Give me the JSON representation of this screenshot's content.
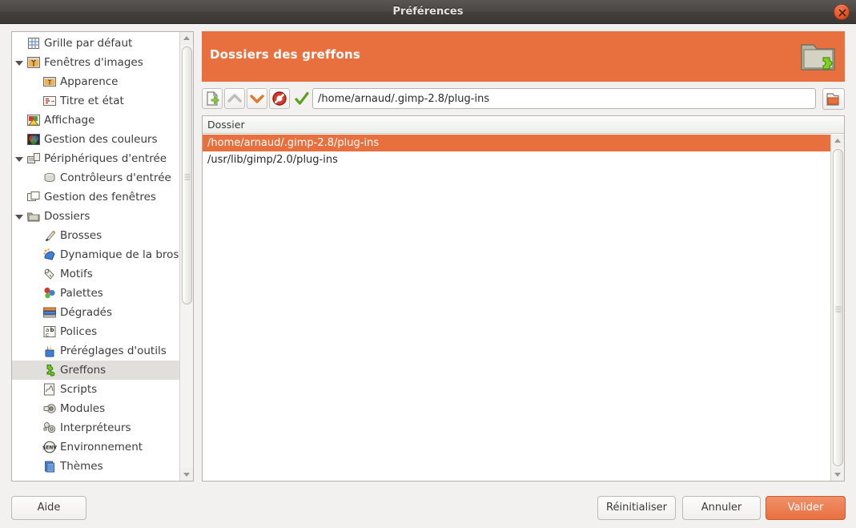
{
  "window": {
    "title": "Préférences",
    "close_icon": "close-icon"
  },
  "colors": {
    "accent": "#e8703f",
    "selection": "#e8703f",
    "tree_selection": "#e0dfdc",
    "panel_bg": "#f2f1f0"
  },
  "sidebar": {
    "items": [
      {
        "label": "Grille par défaut",
        "depth": 0,
        "icon": "grid-icon",
        "expander": "none",
        "selected": false
      },
      {
        "label": "Fenêtres d'images",
        "depth": 0,
        "icon": "image-window-icon",
        "expander": "expanded",
        "selected": false
      },
      {
        "label": "Apparence",
        "depth": 1,
        "icon": "appearance-icon",
        "expander": "none",
        "selected": false
      },
      {
        "label": "Titre et état",
        "depth": 1,
        "icon": "title-status-icon",
        "expander": "none",
        "selected": false
      },
      {
        "label": "Affichage",
        "depth": 0,
        "icon": "display-icon",
        "expander": "none",
        "selected": false
      },
      {
        "label": "Gestion des couleurs",
        "depth": 0,
        "icon": "color-management-icon",
        "expander": "none",
        "selected": false
      },
      {
        "label": "Périphériques d'entrée",
        "depth": 0,
        "icon": "input-devices-icon",
        "expander": "expanded",
        "selected": false
      },
      {
        "label": "Contrôleurs d'entrée",
        "depth": 1,
        "icon": "input-controllers-icon",
        "expander": "none",
        "selected": false
      },
      {
        "label": "Gestion des fenêtres",
        "depth": 0,
        "icon": "window-management-icon",
        "expander": "none",
        "selected": false
      },
      {
        "label": "Dossiers",
        "depth": 0,
        "icon": "folders-icon",
        "expander": "expanded",
        "selected": false
      },
      {
        "label": "Brosses",
        "depth": 1,
        "icon": "brush-icon",
        "expander": "none",
        "selected": false
      },
      {
        "label": "Dynamique de la brosse",
        "depth": 1,
        "icon": "brush-dynamics-icon",
        "expander": "none",
        "selected": false
      },
      {
        "label": "Motifs",
        "depth": 1,
        "icon": "patterns-icon",
        "expander": "none",
        "selected": false
      },
      {
        "label": "Palettes",
        "depth": 1,
        "icon": "palettes-icon",
        "expander": "none",
        "selected": false
      },
      {
        "label": "Dégradés",
        "depth": 1,
        "icon": "gradients-icon",
        "expander": "none",
        "selected": false
      },
      {
        "label": "Polices",
        "depth": 1,
        "icon": "fonts-icon",
        "expander": "none",
        "selected": false
      },
      {
        "label": "Préréglages d'outils",
        "depth": 1,
        "icon": "tool-presets-icon",
        "expander": "none",
        "selected": false
      },
      {
        "label": "Greffons",
        "depth": 1,
        "icon": "plugins-icon",
        "expander": "none",
        "selected": true
      },
      {
        "label": "Scripts",
        "depth": 1,
        "icon": "scripts-icon",
        "expander": "none",
        "selected": false
      },
      {
        "label": "Modules",
        "depth": 1,
        "icon": "modules-icon",
        "expander": "none",
        "selected": false
      },
      {
        "label": "Interpréteurs",
        "depth": 1,
        "icon": "interpreters-icon",
        "expander": "none",
        "selected": false
      },
      {
        "label": "Environnement",
        "depth": 1,
        "icon": "environment-icon",
        "expander": "none",
        "selected": false
      },
      {
        "label": "Thèmes",
        "depth": 1,
        "icon": "themes-icon",
        "expander": "none",
        "selected": false
      }
    ]
  },
  "pane": {
    "title": "Dossiers des greffons",
    "header_icon": "folder-plugins-icon",
    "toolbar": [
      {
        "name": "new-folder-button",
        "icon": "new-document-icon",
        "enabled": true
      },
      {
        "name": "move-up-button",
        "icon": "arrow-up-icon",
        "enabled": false
      },
      {
        "name": "move-down-button",
        "icon": "arrow-down-icon",
        "enabled": true
      },
      {
        "name": "delete-button",
        "icon": "forbidden-icon",
        "enabled": true
      },
      {
        "name": "validate-button",
        "icon": "checkmark-icon",
        "enabled": true
      }
    ],
    "path_entry": {
      "value": "/home/arnaud/.gimp-2.8/plug-ins",
      "placeholder": "/home/arnaud/.gimp-2.8/plug-ins"
    },
    "browse_button_icon": "folder-open-icon",
    "list": {
      "column_header": "Dossier",
      "rows": [
        {
          "path": "/home/arnaud/.gimp-2.8/plug-ins",
          "selected": true
        },
        {
          "path": "/usr/lib/gimp/2.0/plug-ins",
          "selected": false
        }
      ]
    }
  },
  "actions": {
    "help": "Aide",
    "reset": "Réinitialiser",
    "cancel": "Annuler",
    "ok": "Valider"
  }
}
